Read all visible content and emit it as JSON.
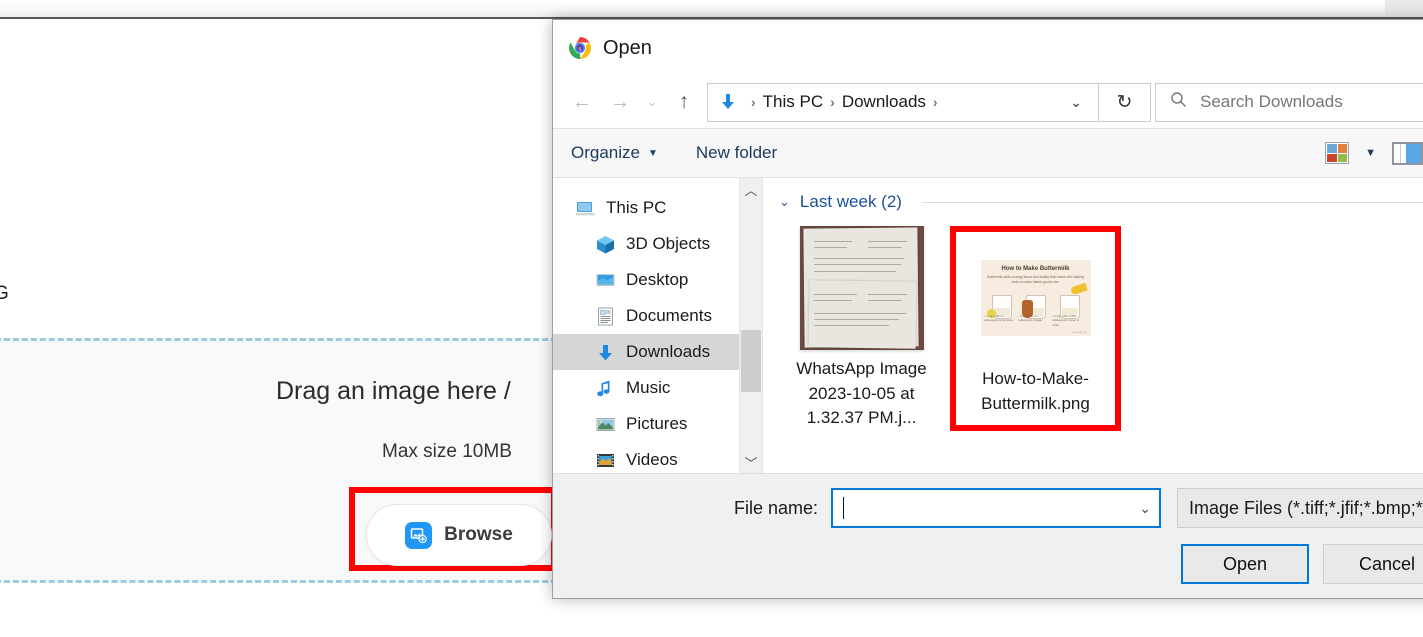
{
  "background_page": {
    "partial_text_left": "G",
    "dropzone": {
      "title": "Drag an image here /",
      "max_size": "Max size 10MB",
      "browse_label": "Browse",
      "browse_icon": "add-image-icon",
      "border_color": "#9ccbe0",
      "background": "#f8f9fa"
    },
    "annotation_color": "#ff0000"
  },
  "dialog": {
    "title": "Open",
    "app_icon": "chrome-icon",
    "nav": {
      "back_icon": "arrow-left-icon",
      "forward_icon": "arrow-right-icon",
      "recent_icon": "chevron-down-icon",
      "up_icon": "arrow-up-icon",
      "refresh_icon": "refresh-icon",
      "breadcrumb_icon": "downloads-arrow-icon",
      "breadcrumb": [
        "This PC",
        "Downloads"
      ],
      "breadcrumb_chevron": "chevron-down-icon"
    },
    "search": {
      "placeholder": "Search Downloads",
      "icon": "search-icon"
    },
    "toolbar": {
      "organize_label": "Organize",
      "organize_caret": "caret-down-icon",
      "new_folder_label": "New folder",
      "view_icon": "view-options-icon",
      "view_caret": "caret-down-icon",
      "preview_pane_icon": "preview-pane-icon"
    },
    "sidebar": {
      "items": [
        {
          "label": "This PC",
          "icon": "this-pc-icon",
          "indent": false,
          "selected": false
        },
        {
          "label": "3D Objects",
          "icon": "3d-objects-icon",
          "indent": true,
          "selected": false
        },
        {
          "label": "Desktop",
          "icon": "desktop-icon",
          "indent": true,
          "selected": false
        },
        {
          "label": "Documents",
          "icon": "documents-icon",
          "indent": true,
          "selected": false
        },
        {
          "label": "Downloads",
          "icon": "downloads-icon",
          "indent": true,
          "selected": true
        },
        {
          "label": "Music",
          "icon": "music-icon",
          "indent": true,
          "selected": false
        },
        {
          "label": "Pictures",
          "icon": "pictures-icon",
          "indent": true,
          "selected": false
        },
        {
          "label": "Videos",
          "icon": "videos-icon",
          "indent": true,
          "selected": false
        }
      ],
      "scroll_up_icon": "chevron-up-icon",
      "scroll_down_icon": "chevron-down-icon"
    },
    "filelist": {
      "group_label": "Last week (2)",
      "group_chevron": "chevron-down-icon",
      "files": [
        {
          "name": "WhatsApp Image 2023-10-05 at 1.32.37 PM.j...",
          "thumbnail": "photo-of-printed-documents",
          "annotated": false
        },
        {
          "name": "How-to-Make-Buttermilk.png",
          "thumbnail": "buttermilk-infographic",
          "annotated": true
        }
      ]
    },
    "footer": {
      "file_name_label": "File name:",
      "file_name_value": "",
      "file_name_chevron": "chevron-down-icon",
      "file_type_filter": "Image Files (*.tiff;*.jfif;*.bmp;*.g",
      "open_label": "Open",
      "cancel_label": "Cancel",
      "accent_color": "#0078d7"
    },
    "infographic": {
      "title": "How to Make Buttermilk",
      "subtitle": "Buttermilk adds a tangy flavor and acidity that reacts with baking soda to make baked goods rise.",
      "columns": [
        "• 1 cup milk  • 1 tablespoon lemon juice",
        "• 1 cup milk  • 1 tablespoon vinegar",
        "• 1 cup milk  • 1-3/4 tablespoons cream of tartar"
      ],
      "footer_text": "www.taste.org"
    }
  }
}
